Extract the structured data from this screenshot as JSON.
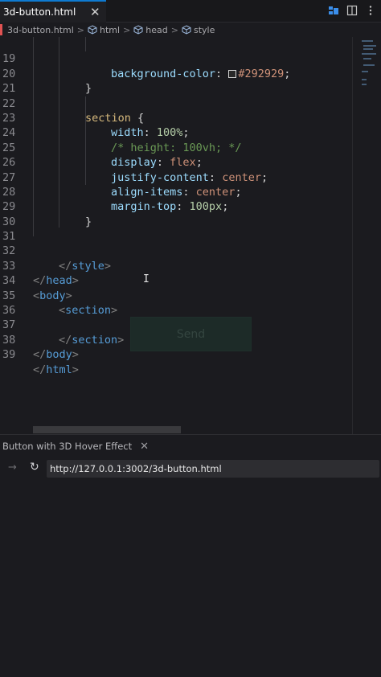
{
  "tab": {
    "label": "3d-button.html",
    "close": "✕"
  },
  "toolbar_icons": [
    "explorer-icon",
    "split-editor-icon",
    "more-icon"
  ],
  "breadcrumb": {
    "file": "3d-button.html",
    "html": "html",
    "head": "head",
    "style": "style",
    "sep": ">"
  },
  "code": {
    "l19": {
      "num": "19",
      "prop": "background-color",
      "colon": ": ",
      "val": "#292929",
      "semi": ";"
    },
    "l20": {
      "num": "20",
      "text": "}"
    },
    "l21": {
      "num": "21"
    },
    "l22": {
      "num": "22",
      "sel": "section",
      "brace": " {"
    },
    "l23": {
      "num": "23",
      "prop": "width",
      "colon": ": ",
      "val": "100%",
      "semi": ";"
    },
    "l24": {
      "num": "24",
      "comment": "/* height: 100vh; */"
    },
    "l25": {
      "num": "25",
      "prop": "display",
      "colon": ": ",
      "val": "flex",
      "semi": ";"
    },
    "l26": {
      "num": "26",
      "prop": "justify-content",
      "colon": ": ",
      "val": "center",
      "semi": ";"
    },
    "l27": {
      "num": "27",
      "prop": "align-items",
      "colon": ": ",
      "val": "center",
      "semi": ";"
    },
    "l28": {
      "num": "28",
      "prop": "margin-top",
      "colon": ": ",
      "val": "100px",
      "semi": ";"
    },
    "l29": {
      "num": "29",
      "text": "}"
    },
    "l30": {
      "num": "30"
    },
    "l31": {
      "num": "31"
    },
    "l32": {
      "num": "32",
      "open": "</",
      "tag": "style",
      "close": ">"
    },
    "l33": {
      "num": "33",
      "open": "</",
      "tag": "head",
      "close": ">"
    },
    "l34": {
      "num": "34",
      "open": "<",
      "tag": "body",
      "close": ">"
    },
    "l35": {
      "num": "35",
      "open": "<",
      "tag": "section",
      "close": ">"
    },
    "l36": {
      "num": "36"
    },
    "l37": {
      "num": "37",
      "open": "</",
      "tag": "section",
      "close": ">"
    },
    "l38": {
      "num": "38",
      "open": "</",
      "tag": "body",
      "close": ">"
    },
    "l39": {
      "num": "39",
      "open": "</",
      "tag": "html",
      "close": ">"
    }
  },
  "overlay_button": {
    "label": "Send"
  },
  "preview": {
    "tab_title": "Button with 3D Hover Effect",
    "tab_close": "✕",
    "back": "→",
    "reload": "↻",
    "url": "http://127.0.0.1:3002/3d-button.html"
  },
  "colors": {
    "accent": "#0e7ad1",
    "swatch": "#292929",
    "editor_bg": "#1b1b1f"
  }
}
